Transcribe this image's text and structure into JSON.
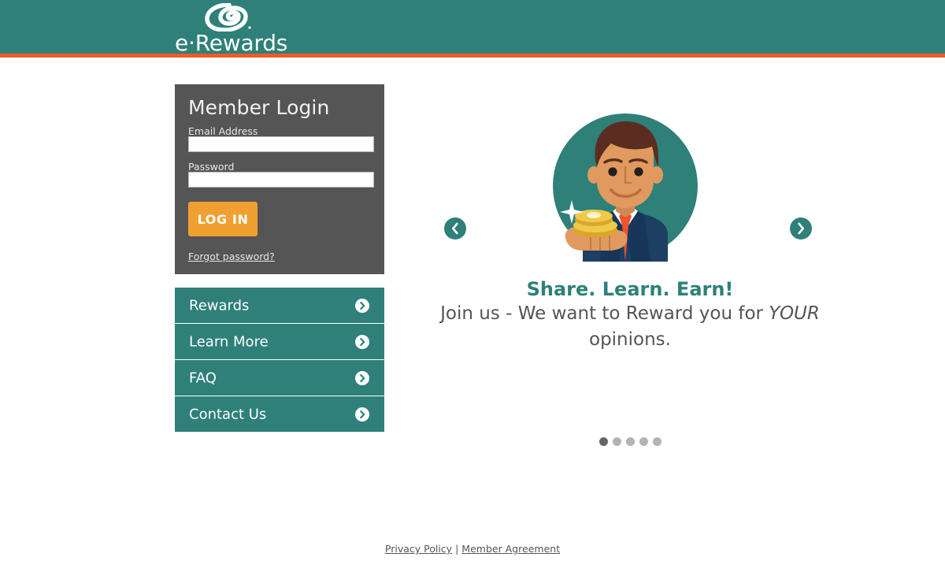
{
  "header": {
    "brand_name": "e·Rewards",
    "logo_icon": "erewards-swirl-logo",
    "bg_color": "#2e8079",
    "stripe_color": "#f05a28"
  },
  "login": {
    "title": "Member Login",
    "email_label": "Email Address",
    "email_value": "",
    "email_placeholder": "",
    "password_label": "Password",
    "password_value": "",
    "password_placeholder": "",
    "submit_label": "LOG IN",
    "submit_color": "#f0a030",
    "forgot_label": "Forgot password?",
    "panel_color": "#555555"
  },
  "nav": {
    "items": [
      {
        "label": "Rewards",
        "icon": "chevron-right-circle-icon"
      },
      {
        "label": "Learn More",
        "icon": "chevron-right-circle-icon"
      },
      {
        "label": "FAQ",
        "icon": "chevron-right-circle-icon"
      },
      {
        "label": "Contact Us",
        "icon": "chevron-right-circle-icon"
      }
    ],
    "item_color": "#2e8079"
  },
  "carousel": {
    "illustration": "businessman-holding-gold-coins-illustration",
    "headline": "Share. Learn. Earn!",
    "subline_line1": "Join us - We want to Reward",
    "subline_before_em": "you for ",
    "subline_em": "YOUR",
    "subline_after_em": " opinions.",
    "headline_color": "#2e8079",
    "prev_icon": "chevron-left-icon",
    "next_icon": "chevron-right-icon",
    "dot_count": 5,
    "active_dot_index": 0
  },
  "footer": {
    "privacy_label": "Privacy Policy",
    "separator": "|",
    "agreement_label": "Member Agreement"
  }
}
